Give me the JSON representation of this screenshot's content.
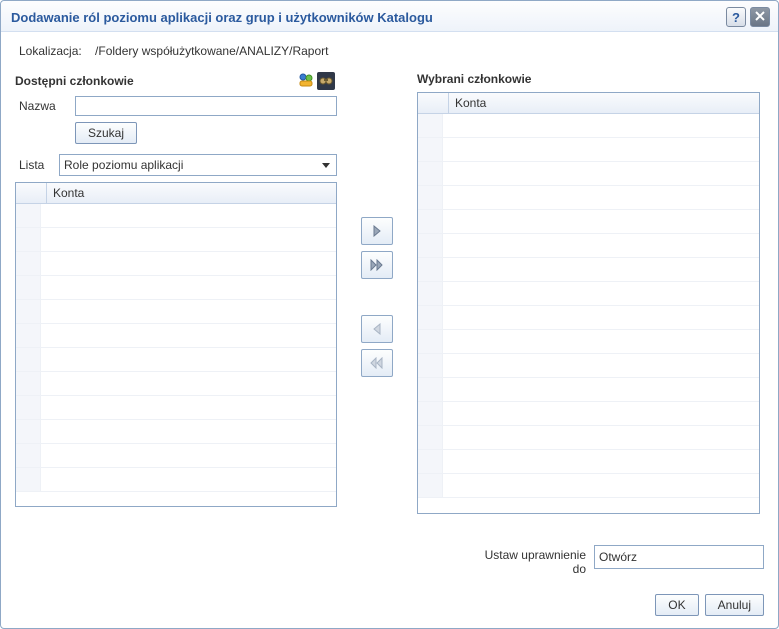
{
  "title": "Dodawanie ról poziomu aplikacji oraz grup i użytkowników Katalogu",
  "location": {
    "label": "Lokalizacja:",
    "path": "/Foldery współużytkowane/ANALIZY/Raport"
  },
  "available": {
    "header": "Dostępni członkowie",
    "name_label": "Nazwa",
    "name_value": "",
    "search_label": "Szukaj",
    "list_label": "Lista",
    "list_selected": "Role poziomu aplikacji",
    "column_header": "Konta"
  },
  "selected": {
    "header": "Wybrani członkowie",
    "column_header": "Konta"
  },
  "permission": {
    "label_line1": "Ustaw uprawnienie",
    "label_line2": "do",
    "selected": "Otwórz"
  },
  "actions": {
    "ok": "OK",
    "cancel": "Anuluj"
  }
}
